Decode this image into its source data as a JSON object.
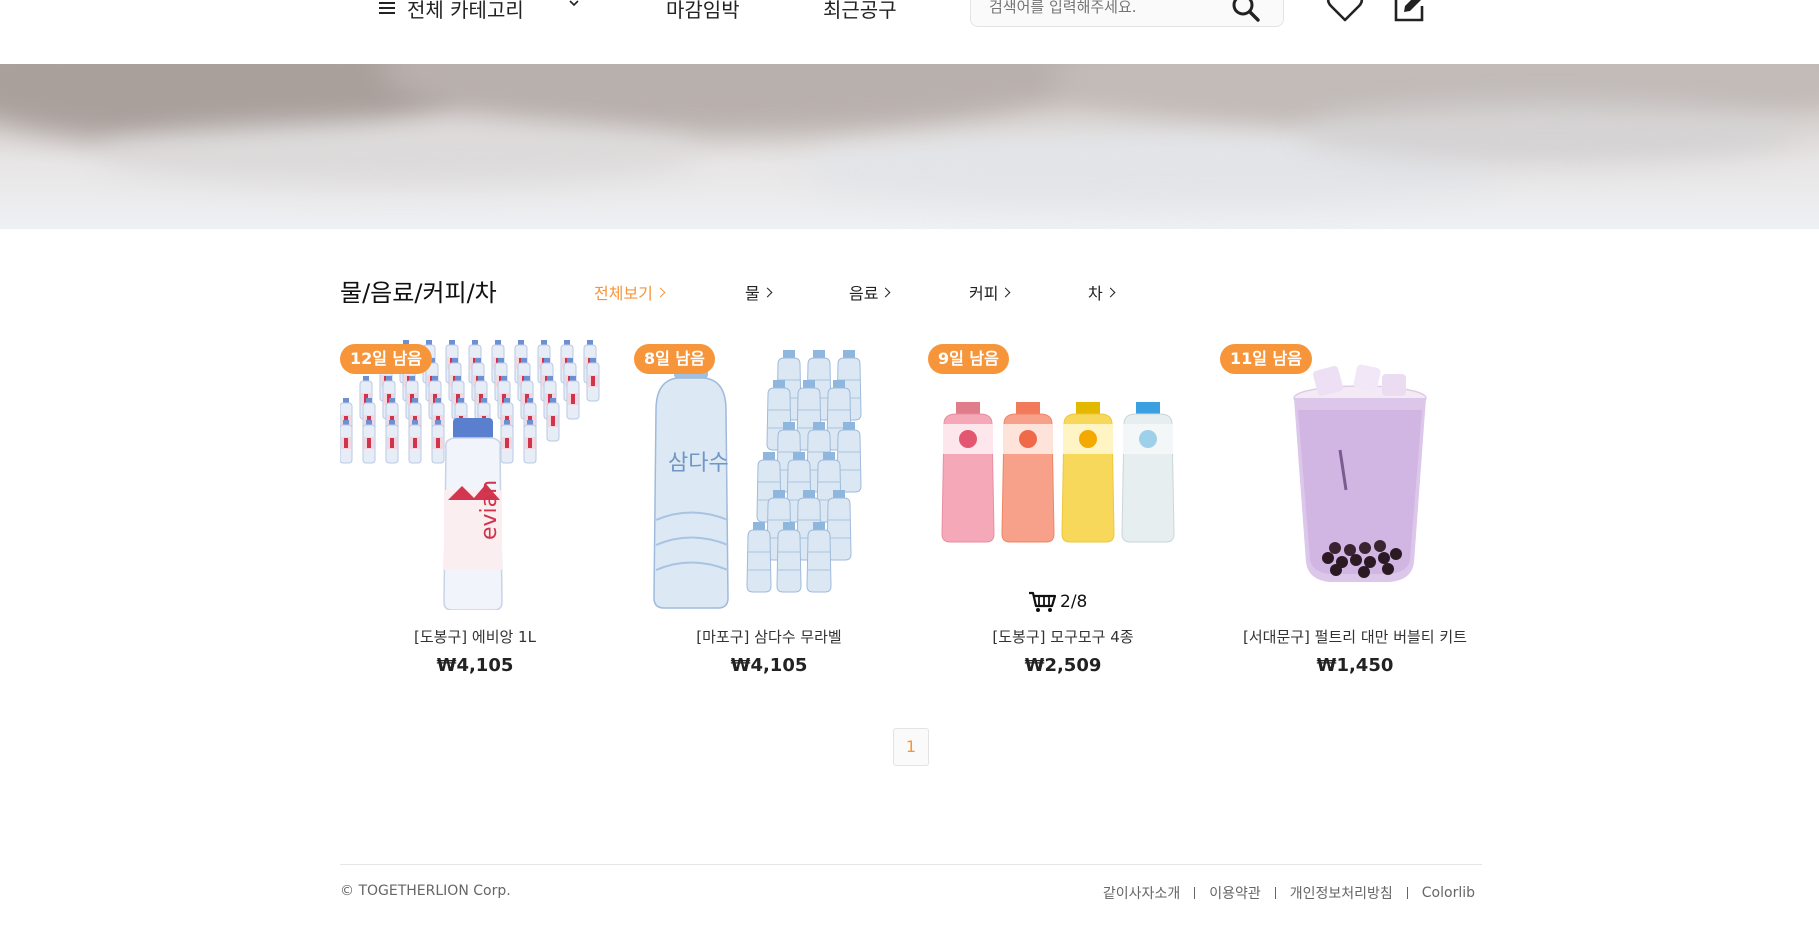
{
  "header": {
    "category_label": "전체 카테고리",
    "nav": [
      "마감임박",
      "최근공구"
    ],
    "search_placeholder": "검색어를 입력해주세요."
  },
  "category": {
    "title": "물/음료/커피/차",
    "tabs": [
      "전체보기",
      "물",
      "음료",
      "커피",
      "차"
    ],
    "active_tab": "전체보기"
  },
  "products": [
    {
      "badge": "12일 남음",
      "name": "[도봉구] 에비앙 1L",
      "price": "₩4,105",
      "icon": "evian-bottles"
    },
    {
      "badge": "8일 남음",
      "name": "[마포구] 삼다수 무라벨",
      "price": "₩4,105",
      "icon": "samdasoo-bottles"
    },
    {
      "badge": "9일 남음",
      "name": "[도봉구] 모구모구 4종",
      "price": "₩2,509",
      "icon": "mogu-bottles",
      "cart_count": "2/8"
    },
    {
      "badge": "11일 남음",
      "name": "[서대문구] 펄트리 대만 버블티 키트",
      "price": "₩1,450",
      "icon": "bubble-tea-cup"
    }
  ],
  "pagination": {
    "current": "1"
  },
  "footer": {
    "copyright": "© TOGETHERLION Corp.",
    "links": [
      "같이사자소개",
      "이용약관",
      "개인정보처리방침",
      "Colorlib"
    ]
  },
  "colors": {
    "accent": "#f7953b",
    "text": "#222222",
    "muted": "#666666"
  }
}
